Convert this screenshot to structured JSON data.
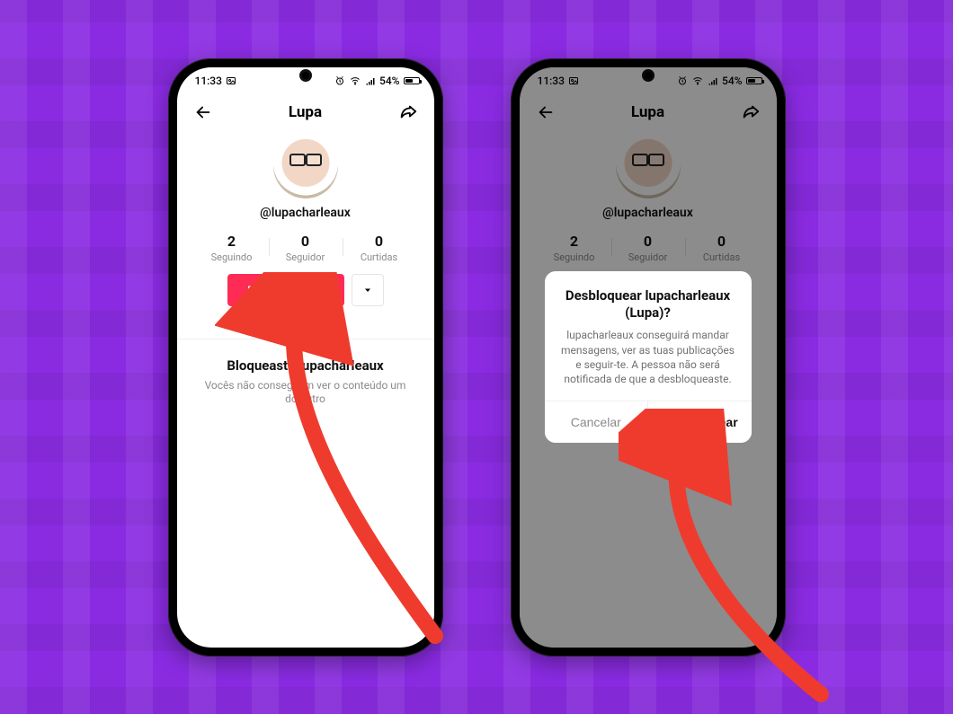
{
  "status": {
    "time": "11:33",
    "battery_text": "54%",
    "battery_fill_pct": 54
  },
  "header": {
    "title": "Lupa"
  },
  "profile": {
    "username": "@lupacharleaux"
  },
  "stats": {
    "following": {
      "count": "2",
      "label": "Seguindo"
    },
    "followers": {
      "count": "0",
      "label": "Seguidor"
    },
    "likes": {
      "count": "0",
      "label": "Curtidas"
    }
  },
  "actions": {
    "unblock_label": "Desbloquear"
  },
  "blocked": {
    "title": "Bloqueaste lupacharleaux",
    "subtitle": "Vocês não conseguem ver o conteúdo um do outro"
  },
  "modal": {
    "title": "Desbloquear lupacharleaux (Lupa)?",
    "body": "lupacharleaux conseguirá mandar mensagens, ver as tuas publicações e seguir-te. A pessoa não será notificada de que a desbloqueaste.",
    "cancel": "Cancelar",
    "confirm": "Desbloquear"
  }
}
